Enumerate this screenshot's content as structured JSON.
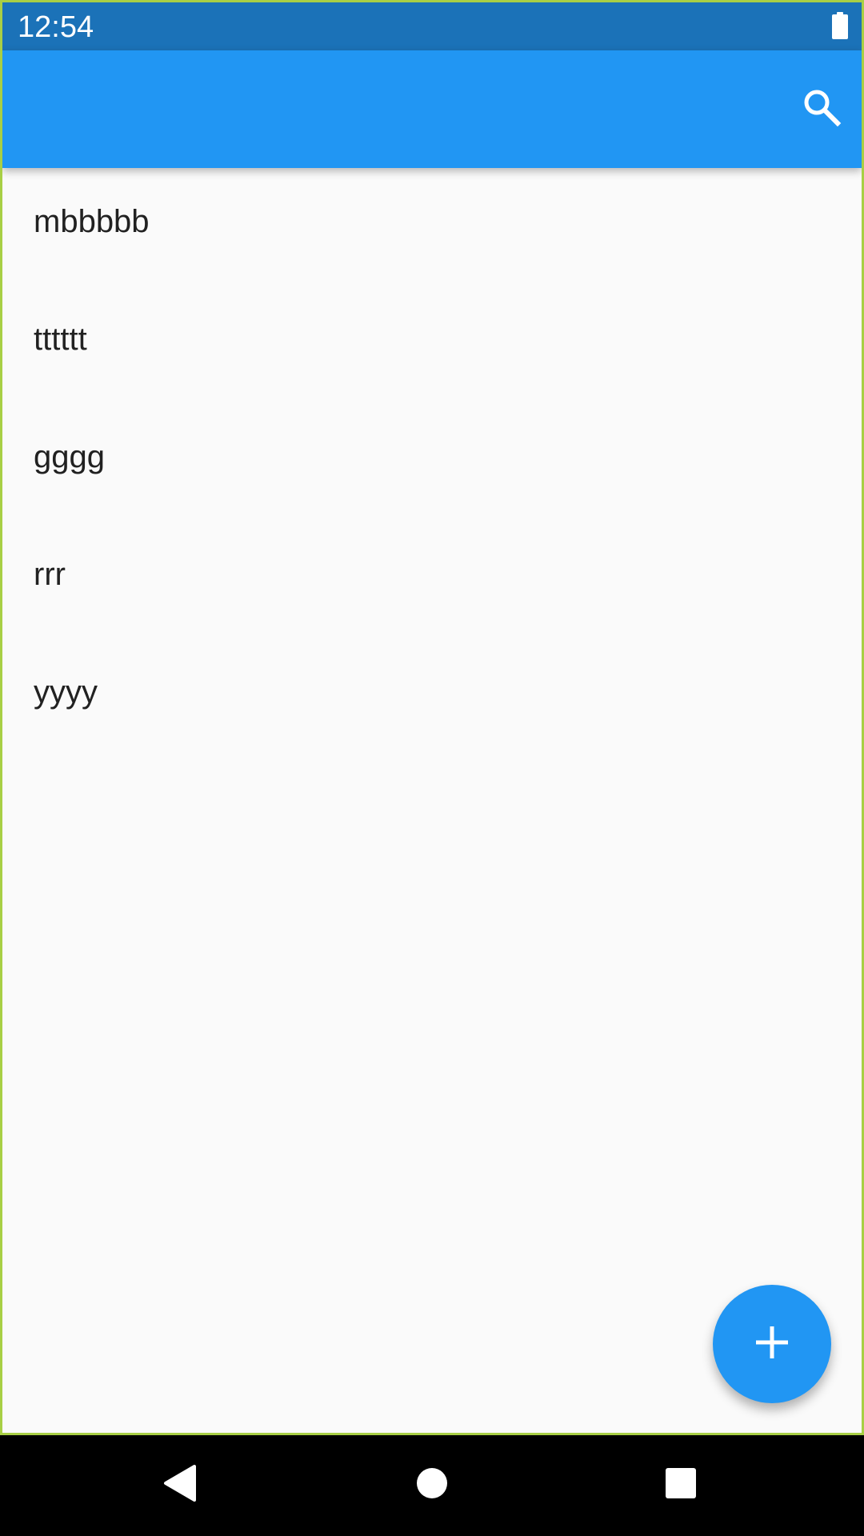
{
  "status_bar": {
    "time": "12:54",
    "battery_icon": "battery-full-icon",
    "background": "#1b72b8"
  },
  "app_bar": {
    "background": "#2196f3",
    "search_icon": "search-icon"
  },
  "list": {
    "items": [
      {
        "label": "mbbbbb"
      },
      {
        "label": "tttttt"
      },
      {
        "label": "gggg"
      },
      {
        "label": "rrr"
      },
      {
        "label": "yyyy"
      }
    ]
  },
  "fab": {
    "icon": "plus-icon",
    "color": "#2196f3"
  },
  "nav_bar": {
    "back_icon": "back-triangle-icon",
    "home_icon": "home-circle-icon",
    "recents_icon": "recents-square-icon"
  }
}
